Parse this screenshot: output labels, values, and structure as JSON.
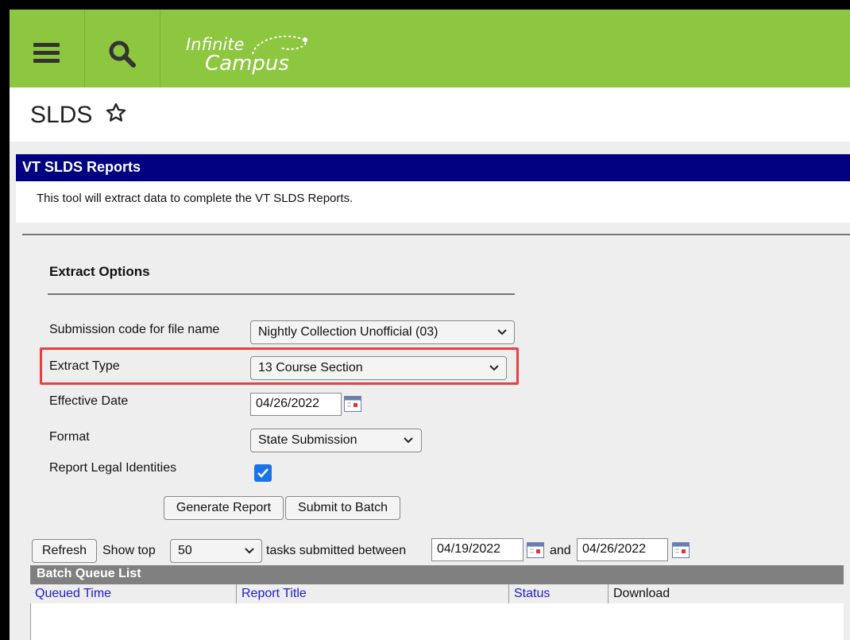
{
  "header": {
    "logo_line1": "Infinite",
    "logo_line2": "Campus"
  },
  "page": {
    "title": "SLDS"
  },
  "report": {
    "title": "VT SLDS Reports",
    "description": "This tool will extract data to complete the VT SLDS Reports."
  },
  "extract_options": {
    "section_title": "Extract Options",
    "submission_code_label": "Submission code for file name",
    "submission_code_value": "Nightly Collection Unofficial (03)",
    "extract_type_label": "Extract Type",
    "extract_type_value": "13 Course Section",
    "effective_date_label": "Effective Date",
    "effective_date_value": "04/26/2022",
    "format_label": "Format",
    "format_value": "State Submission",
    "legal_identities_label": "Report Legal Identities",
    "legal_identities_checked": true,
    "generate_label": "Generate Report",
    "submit_batch_label": "Submit to Batch"
  },
  "batch": {
    "refresh_label": "Refresh",
    "show_top_label": "Show top",
    "show_top_value": "50",
    "between_label": "tasks submitted between",
    "start_date": "04/19/2022",
    "and_label": "and",
    "end_date": "04/26/2022",
    "list_title": "Batch Queue List",
    "columns": [
      "Queued Time",
      "Report Title",
      "Status",
      "Download"
    ]
  },
  "colors": {
    "topbar": "#8dc63f",
    "report_header": "#000080",
    "highlight": "#e84040",
    "link": "#1a1adb"
  }
}
